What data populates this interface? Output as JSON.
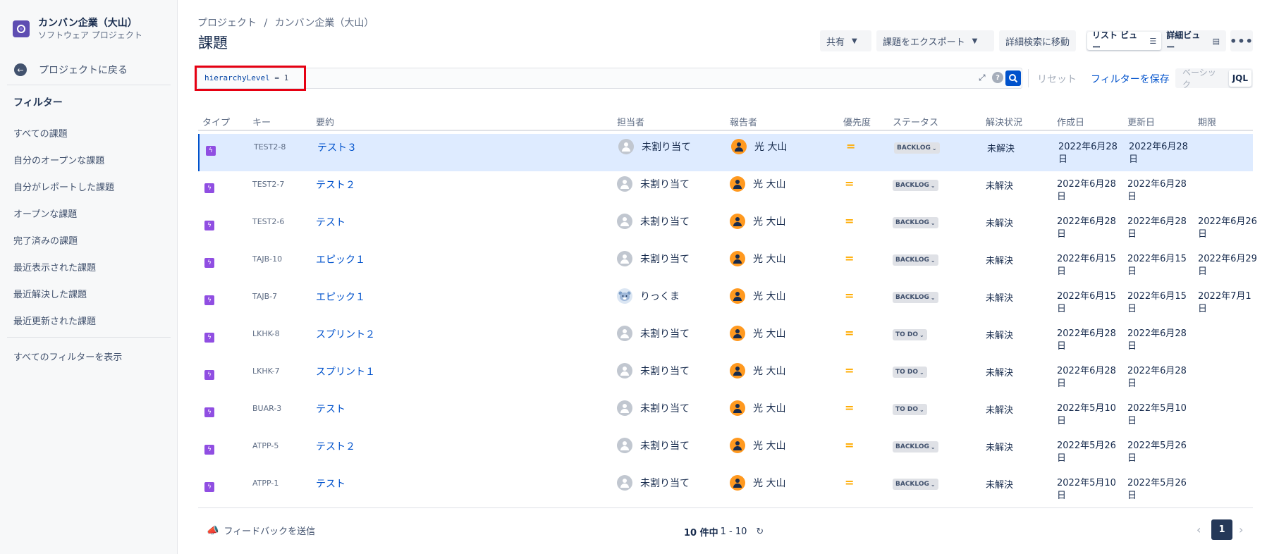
{
  "sidebar": {
    "project_name": "カンバン企業（大山）",
    "project_type": "ソフトウェア プロジェクト",
    "back_label": "プロジェクトに戻る",
    "filters_title": "フィルター",
    "items": [
      {
        "label": "すべての課題"
      },
      {
        "label": "自分のオープンな課題"
      },
      {
        "label": "自分がレポートした課題"
      },
      {
        "label": "オープンな課題"
      },
      {
        "label": "完了済みの課題"
      },
      {
        "label": "最近表示された課題"
      },
      {
        "label": "最近解決した課題"
      },
      {
        "label": "最近更新された課題"
      }
    ],
    "all_filters_label": "すべてのフィルターを表示"
  },
  "header": {
    "breadcrumb": [
      "プロジェクト",
      "/",
      "カンバン企業（大山）"
    ],
    "title": "課題",
    "share_label": "共有",
    "export_label": "課題をエクスポート",
    "advanced_search_label": "詳細検索に移動",
    "list_view_label": "リスト ビュー",
    "detail_view_label": "詳細ビュー",
    "more_label": "•••"
  },
  "search": {
    "jql_field": "hierarchyLevel",
    "jql_operator": "=",
    "jql_value": "1",
    "reset_label": "リセット",
    "save_filter_label": "フィルターを保存",
    "basic_label": "ベーシック",
    "jql_label": "JQL"
  },
  "table": {
    "columns": [
      "タイプ",
      "キー",
      "要約",
      "担当者",
      "報告者",
      "優先度",
      "ステータス",
      "解決状況",
      "作成日",
      "更新日",
      "期限"
    ],
    "rows": [
      {
        "key": "TEST2-8",
        "summary": "テスト３",
        "assignee": "未割り当て",
        "reporter": "光 大山",
        "priority": "=",
        "status": "BACKLOG",
        "resolution": "未解決",
        "created": "2022年6月28日",
        "updated": "2022年6月28日",
        "due": ""
      },
      {
        "key": "TEST2-7",
        "summary": "テスト２",
        "assignee": "未割り当て",
        "reporter": "光 大山",
        "priority": "=",
        "status": "BACKLOG",
        "resolution": "未解決",
        "created": "2022年6月28日",
        "updated": "2022年6月28日",
        "due": ""
      },
      {
        "key": "TEST2-6",
        "summary": "テスト",
        "assignee": "未割り当て",
        "reporter": "光 大山",
        "priority": "=",
        "status": "BACKLOG",
        "resolution": "未解決",
        "created": "2022年6月28日",
        "updated": "2022年6月28日",
        "due": "2022年6月26日"
      },
      {
        "key": "TAJB-10",
        "summary": "エピック１",
        "assignee": "未割り当て",
        "reporter": "光 大山",
        "priority": "=",
        "status": "BACKLOG",
        "resolution": "未解決",
        "created": "2022年6月15日",
        "updated": "2022年6月15日",
        "due": "2022年6月29日"
      },
      {
        "key": "TAJB-7",
        "summary": "エピック１",
        "assignee": "りっくま",
        "reporter": "光 大山",
        "priority": "=",
        "status": "BACKLOG",
        "resolution": "未解決",
        "created": "2022年6月15日",
        "updated": "2022年6月15日",
        "due": "2022年7月1日"
      },
      {
        "key": "LKHK-8",
        "summary": "スプリント２",
        "assignee": "未割り当て",
        "reporter": "光 大山",
        "priority": "=",
        "status": "TO DO",
        "resolution": "未解決",
        "created": "2022年6月28日",
        "updated": "2022年6月28日",
        "due": ""
      },
      {
        "key": "LKHK-7",
        "summary": "スプリント１",
        "assignee": "未割り当て",
        "reporter": "光 大山",
        "priority": "=",
        "status": "TO DO",
        "resolution": "未解決",
        "created": "2022年6月28日",
        "updated": "2022年6月28日",
        "due": ""
      },
      {
        "key": "BUAR-3",
        "summary": "テスト",
        "assignee": "未割り当て",
        "reporter": "光 大山",
        "priority": "=",
        "status": "TO DO",
        "resolution": "未解決",
        "created": "2022年5月10日",
        "updated": "2022年5月10日",
        "due": ""
      },
      {
        "key": "ATPP-5",
        "summary": "テスト２",
        "assignee": "未割り当て",
        "reporter": "光 大山",
        "priority": "=",
        "status": "BACKLOG",
        "resolution": "未解決",
        "created": "2022年5月26日",
        "updated": "2022年5月26日",
        "due": ""
      },
      {
        "key": "ATPP-1",
        "summary": "テスト",
        "assignee": "未割り当て",
        "reporter": "光 大山",
        "priority": "=",
        "status": "BACKLOG",
        "resolution": "未解決",
        "created": "2022年5月10日",
        "updated": "2022年5月26日",
        "due": ""
      }
    ]
  },
  "footer": {
    "feedback_label": "フィードバックを送信",
    "count_prefix": "10 件中",
    "count_range": "1 - 10",
    "current_page": "1"
  },
  "colors": {
    "accent": "#0052cc",
    "highlight_box": "#e60012",
    "selected_row": "#deebff",
    "issue_type": "#904ee2",
    "priority_medium": "#ffab00"
  },
  "icons": {
    "project_logo": "project-logo-icon",
    "back": "arrow-left-icon",
    "expand": "expand-icon",
    "help": "help-icon",
    "search": "search-icon",
    "issue_type": "subtask-icon",
    "unassigned_avatar": "user-avatar-icon",
    "refresh": "refresh-icon",
    "feedback": "megaphone-icon"
  }
}
